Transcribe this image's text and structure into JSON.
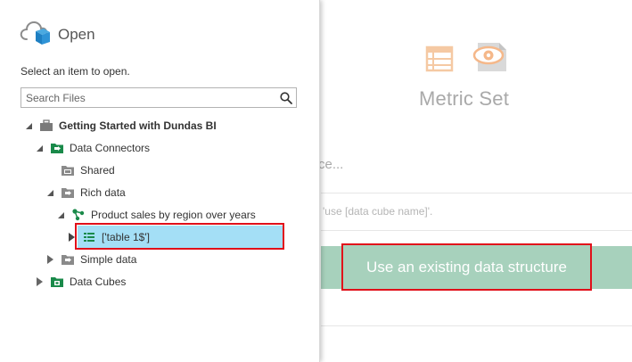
{
  "main": {
    "title": "Metric Set",
    "source_text": "rce...",
    "hint_text": "g 'use [data cube name]'.",
    "use_existing_button": "Use an existing data structure",
    "icons": [
      "data-table-icon",
      "eye-view-icon"
    ]
  },
  "panel": {
    "title": "Open",
    "title_icon": "cloud-icon",
    "prompt": "Select an item to open.",
    "search": {
      "placeholder": "Search Files",
      "icon": "search-icon"
    },
    "tree": {
      "project": "Getting Started with Dundas BI",
      "data_connectors": "Data Connectors",
      "shared": "Shared",
      "rich_data": "Rich data",
      "product_sales": "Product sales by region over years",
      "table1": "['table 1$']",
      "simple_data": "Simple data",
      "data_cubes": "Data Cubes"
    }
  },
  "colors": {
    "accent_green": "#a7d1bc",
    "selection_blue": "#a4dff6",
    "highlight_red": "#e1101a",
    "icon_green": "#1a8a4a"
  }
}
